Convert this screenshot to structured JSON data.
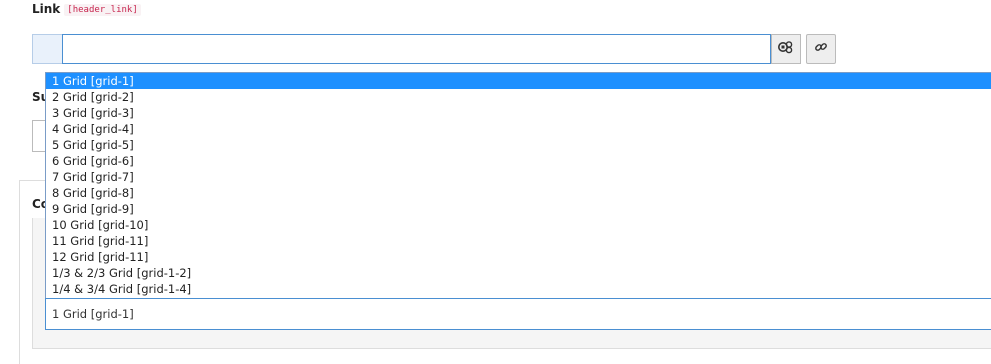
{
  "link_field": {
    "label": "Link",
    "code": "[header_link]",
    "value": ""
  },
  "partial_labels": {
    "subheader": "Su",
    "columns": "Co"
  },
  "dropdown": {
    "options": [
      "1 Grid [grid-1]",
      "2 Grid [grid-2]",
      "3 Grid [grid-3]",
      "4 Grid [grid-4]",
      "5 Grid [grid-5]",
      "6 Grid [grid-6]",
      "7 Grid [grid-7]",
      "8 Grid [grid-8]",
      "9 Grid [grid-9]",
      "10 Grid [grid-10]",
      "11 Grid [grid-11]",
      "12 Grid [grid-11]",
      "1/3 & 2/3 Grid [grid-1-2]",
      "1/4 & 3/4 Grid [grid-1-4]"
    ],
    "selected_index": 0,
    "selected_value": "1 Grid [grid-1]"
  },
  "icons": {
    "browse": "link-browser-icon",
    "link": "chain-link-icon"
  },
  "colors": {
    "highlight": "#1e90ff",
    "focus_border": "#4a8fd2",
    "code_text": "#c7254e"
  }
}
